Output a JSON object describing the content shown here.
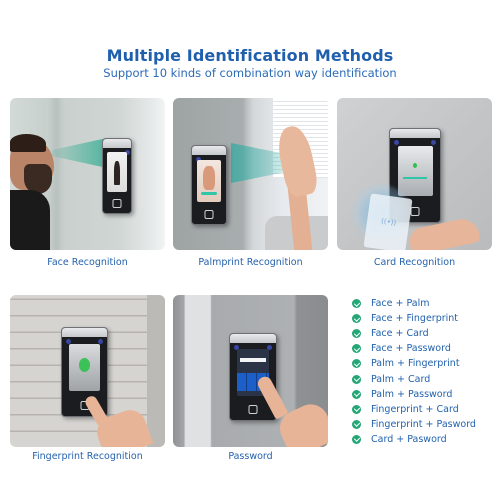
{
  "header": {
    "title": "Multiple Identification Methods",
    "subtitle": "Support 10 kinds of combination way identification"
  },
  "methods": [
    {
      "id": "face",
      "label": "Face Recognition"
    },
    {
      "id": "palm",
      "label": "Palmprint Recognition"
    },
    {
      "id": "card",
      "label": "Card Recognition"
    },
    {
      "id": "fingerprint",
      "label": "Fingerprint Recognition"
    },
    {
      "id": "password",
      "label": "Password"
    }
  ],
  "combinations": {
    "icon": "check-circle-icon",
    "icon_color": "#24a676",
    "text_color": "#2162ae",
    "items": [
      "Face + Palm",
      "Face + Fingerprint",
      "Face + Card",
      "Face + Password",
      "Palm + Fingerprint",
      "Palm + Card",
      "Palm + Password",
      "Fingerprint + Card",
      "Fingerprint + Pasword",
      "Card + Pasword"
    ]
  },
  "colors": {
    "title": "#1f5fae",
    "subtitle": "#2b6bb8",
    "caption": "#2462ad",
    "background": "#ffffff"
  }
}
